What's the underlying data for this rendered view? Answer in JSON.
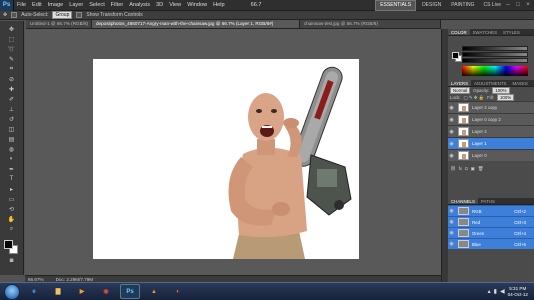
{
  "menubar": {
    "logo": "Ps",
    "items": [
      "File",
      "Edit",
      "Image",
      "Layer",
      "Select",
      "Filter",
      "Analysis",
      "3D",
      "View",
      "Window",
      "Help"
    ],
    "zoom": "66.7",
    "workspaces": [
      "ESSENTIALS",
      "DESIGN",
      "PAINTING"
    ],
    "cs_live": "CS Live"
  },
  "options": {
    "auto_select_label": "Auto-Select:",
    "auto_select_value": "Group",
    "transform_label": "Show Transform Controls"
  },
  "tabs": [
    "Untitled-1 @ 66.7% (RGB/8)",
    "depositphotos_4860717-Angry-man-with-the-chainsaw.jpg @ 66.7% (Layer 1, RGB/8#)",
    "chainsaw-test.jpg @ 66.7% (RGB/8)"
  ],
  "status": {
    "zoom": "66.67%",
    "doc": "Doc: 2.29M/7.79M"
  },
  "color_panel": {
    "tabs": [
      "COLOR",
      "SWATCHES",
      "STYLES"
    ]
  },
  "layers_panel": {
    "tabs": [
      "LAYERS",
      "ADJUSTMENTS",
      "MASKS"
    ],
    "blend": "Normal",
    "opacity_label": "Opacity:",
    "opacity": "100%",
    "lock_label": "Lock:",
    "fill_label": "Fill:",
    "fill": "100%",
    "layers": [
      {
        "name": "Layer 2 copy",
        "selected": false
      },
      {
        "name": "Layer 0 copy 2",
        "selected": false
      },
      {
        "name": "Layer 2",
        "selected": false
      },
      {
        "name": "Layer 1",
        "selected": true
      },
      {
        "name": "Layer 0",
        "selected": false
      }
    ]
  },
  "channels_panel": {
    "tabs": [
      "CHANNELS",
      "PATHS"
    ],
    "channels": [
      {
        "name": "RGB",
        "shortcut": "Ctrl+2"
      },
      {
        "name": "Red",
        "shortcut": "Ctrl+3"
      },
      {
        "name": "Green",
        "shortcut": "Ctrl+4"
      },
      {
        "name": "Blue",
        "shortcut": "Ctrl+5"
      }
    ]
  },
  "taskbar": {
    "time": "5:31 PM",
    "date": "04-Oct-12"
  },
  "colors": {
    "accent_selected": "#3d7fd9",
    "ps_blue": "#1c3b5a"
  }
}
